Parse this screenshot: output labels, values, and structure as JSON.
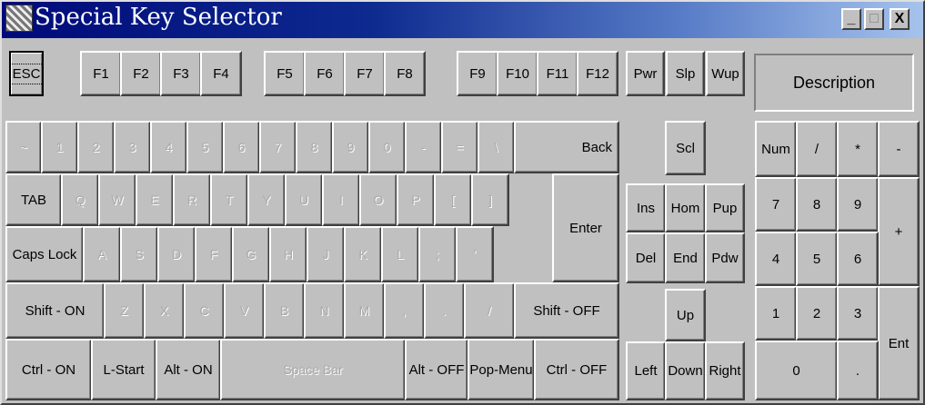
{
  "window": {
    "title": "Special Key Selector",
    "minimize": "_",
    "maximize": "□",
    "close": "X"
  },
  "function_row": {
    "esc": "ESC",
    "f1": "F1",
    "f2": "F2",
    "f3": "F3",
    "f4": "F4",
    "f5": "F5",
    "f6": "F6",
    "f7": "F7",
    "f8": "F8",
    "f9": "F9",
    "f10": "F10",
    "f11": "F11",
    "f12": "F12",
    "pwr": "Pwr",
    "slp": "Slp",
    "wup": "Wup",
    "description": "Description"
  },
  "main": {
    "row1": [
      "~",
      "1",
      "2",
      "3",
      "4",
      "5",
      "6",
      "7",
      "8",
      "9",
      "0",
      "-",
      "=",
      "\\",
      "Back"
    ],
    "row2": [
      "TAB",
      "Q",
      "W",
      "E",
      "R",
      "T",
      "Y",
      "U",
      "I",
      "O",
      "P",
      "[",
      "]"
    ],
    "enter": "Enter",
    "row3": [
      "Caps Lock",
      "A",
      "S",
      "D",
      "F",
      "G",
      "H",
      "J",
      "K",
      "L",
      ";",
      "'"
    ],
    "row4": [
      "Shift - ON",
      "Z",
      "X",
      "C",
      "V",
      "B",
      "N",
      "M",
      ",",
      ".",
      "/",
      "Shift - OFF"
    ],
    "row5": [
      "Ctrl - ON",
      "L-Start",
      "Alt - ON",
      "Space Bar",
      "Alt - OFF",
      "Pop-Menu",
      "Ctrl - OFF"
    ]
  },
  "nav": {
    "scl": "Scl",
    "ins": "Ins",
    "hom": "Hom",
    "pup": "Pup",
    "del": "Del",
    "end": "End",
    "pdw": "Pdw",
    "up": "Up",
    "left": "Left",
    "down": "Down",
    "right": "Right"
  },
  "numpad": {
    "num": "Num",
    "div": "/",
    "mul": "*",
    "minus": "-",
    "n7": "7",
    "n8": "8",
    "n9": "9",
    "plus": "+",
    "n4": "4",
    "n5": "5",
    "n6": "6",
    "n1": "1",
    "n2": "2",
    "n3": "3",
    "ent": "Ent",
    "n0": "0",
    "dot": "."
  }
}
